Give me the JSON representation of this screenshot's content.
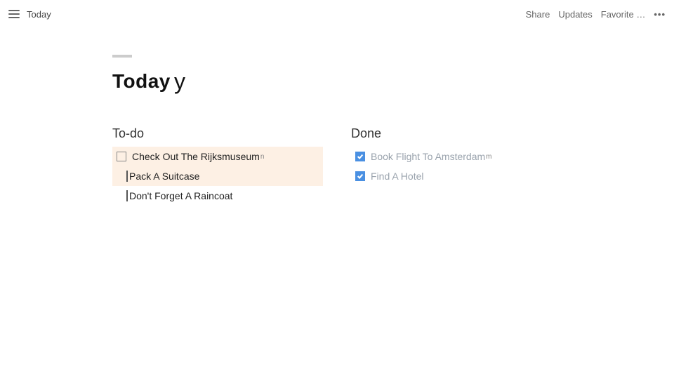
{
  "topbar": {
    "breadcrumb": "Today",
    "actions": {
      "share": "Share",
      "updates": "Updates",
      "favorite_trunc": "Favorite …"
    }
  },
  "page": {
    "title": "Today"
  },
  "columns": {
    "todo": {
      "header": "To-do",
      "items": [
        {
          "label": "Check Out The Rijksmuseum",
          "checked": false,
          "highlight": true,
          "indent": false,
          "showBox": true
        },
        {
          "label": "Pack A Suitcase",
          "checked": false,
          "highlight": true,
          "indent": true,
          "showBox": false
        },
        {
          "label": "Don't Forget A Raincoat",
          "checked": false,
          "highlight": false,
          "indent": true,
          "showBox": false
        }
      ]
    },
    "done": {
      "header": "Done",
      "items": [
        {
          "label": "Book Flight To Amsterdam",
          "checked": true
        },
        {
          "label": "Find A Hotel",
          "checked": true
        }
      ]
    }
  }
}
